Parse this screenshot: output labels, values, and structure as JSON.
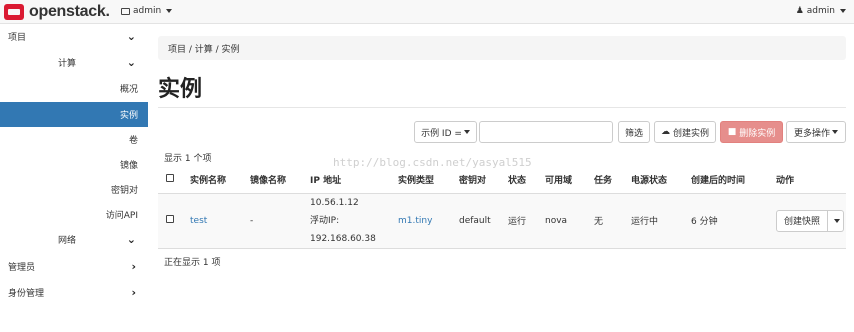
{
  "topbar": {
    "brand": "openstack.",
    "project_label": "admin",
    "user_label": "admin"
  },
  "sidebar": {
    "items": [
      {
        "label": "项目",
        "chevron": "⌄"
      },
      {
        "label": "计算",
        "chevron": "⌄"
      },
      {
        "label": "概况"
      },
      {
        "label": "实例"
      },
      {
        "label": "卷"
      },
      {
        "label": "镜像"
      },
      {
        "label": "密钥对"
      },
      {
        "label": "访问API"
      },
      {
        "label": "网络",
        "chevron": "⌄"
      },
      {
        "label": "管理员",
        "chevron": "›"
      },
      {
        "label": "身份管理",
        "chevron": "›"
      }
    ]
  },
  "breadcrumb": "项目 / 计算 / 实例",
  "page_title": "实例",
  "toolbar": {
    "filter_select": "示例 ID =",
    "filter_button": "筛选",
    "create_button": "创建实例",
    "delete_button": "删除实例",
    "more_button": "更多操作"
  },
  "count_top": "显示 1 个项",
  "count_bottom": "正在显示 1 项",
  "watermark": "http://blog.csdn.net/yasyal515",
  "table": {
    "headers": [
      "实例名称",
      "镜像名称",
      "IP 地址",
      "实例类型",
      "密钥对",
      "状态",
      "可用域",
      "任务",
      "电源状态",
      "创建后的时间",
      "动作"
    ],
    "rows": [
      {
        "name": "test",
        "image": "-",
        "ip_1": "10.56.1.12",
        "ip_2": "浮动IP:",
        "ip_3": "192.168.60.38",
        "flavor": "m1.tiny",
        "keypair": "default",
        "status": "运行",
        "zone": "nova",
        "task": "无",
        "power": "运行中",
        "age": "6 分钟",
        "action": "创建快照"
      }
    ]
  },
  "colors": {
    "active_nav": "#3278b3",
    "brand_red": "#da1a32",
    "danger": "#d9534f",
    "link": "#3278b3"
  }
}
